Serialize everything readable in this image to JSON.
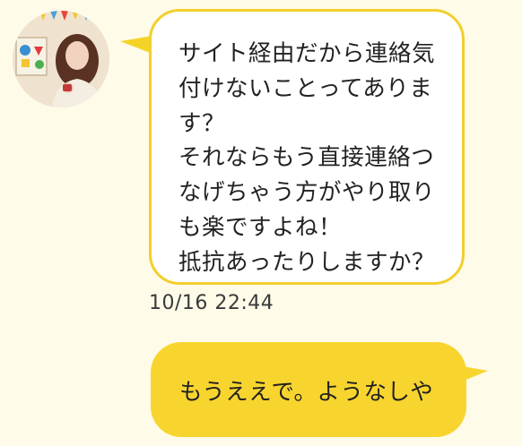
{
  "colors": {
    "background": "#fefbe8",
    "incoming_bubble": "#ffffff",
    "incoming_border": "#f2cf2c",
    "outgoing_bubble": "#f8d52e"
  },
  "incoming": {
    "avatar_icon": "profile-photo-avatar",
    "lines": [
      "サイト経由だから連絡気",
      "付けないことってありま",
      "す？",
      "それならもう直接連絡つ",
      "なげちゃう方がやり取り",
      "も楽ですよね！",
      "抵抗あったりしますか？"
    ],
    "timestamp": "10/16 22:44"
  },
  "outgoing": {
    "text": "もうええで。ようなしや"
  }
}
